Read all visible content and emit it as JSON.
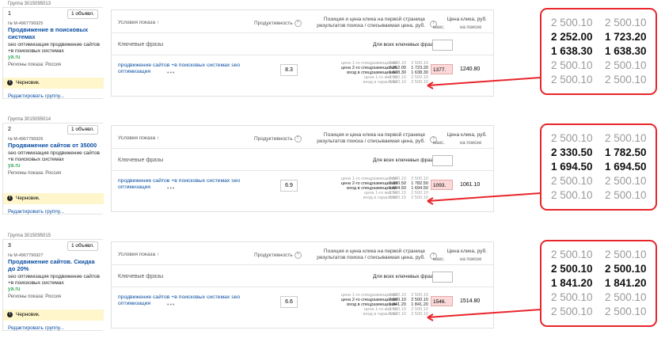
{
  "blocks": [
    {
      "group": "Группа 3015095013",
      "num": "1",
      "ads_button": "1 объявл.",
      "ad_id": "№ М-4967796925",
      "title": "Продвижение в поисковых системах",
      "text": "seo оптимизация продвижение сайтов +в поисковых системах",
      "domain": "ya.ru",
      "regions": "Регионы показа: Россия",
      "draft": "Черновик.",
      "edit": "Редактировать группу...",
      "phrase": "продвижение сайтов +в поисковых системах seo оптимизация",
      "productivity": "8.3",
      "labels": [
        "цена 1-го спецразмещения",
        "цена 2-го спецразмещения",
        "вход в спецразмещение",
        "цена 1-го места",
        "вход в гарантию"
      ],
      "col1": [
        "2 500.10",
        "2 252.00",
        "1 638.30",
        "2 500.10",
        "2 500.10"
      ],
      "col2": [
        "2 500.10",
        "1 723.20",
        "1 638.30",
        "2 500.10",
        "2 500.10"
      ],
      "bid_max": "1377.",
      "on_search": "1240.80",
      "zoom": [
        [
          "2 500.10",
          "2 500.10"
        ],
        [
          "2 252.00",
          "1 723.20"
        ],
        [
          "1 638.30",
          "1 638.30"
        ],
        [
          "2 500.10",
          "2 500.10"
        ],
        [
          "2 500.10",
          "2 500.10"
        ]
      ]
    },
    {
      "group": "Группа 3015095014",
      "num": "2",
      "ads_button": "1 объявл.",
      "ad_id": "№ М-4967796926",
      "title": "Продвижение сайтов от 35000",
      "text": "seo оптимизация продвижение сайтов +в поисковых системах",
      "domain": "ya.ru",
      "regions": "Регионы показа: Россия",
      "draft": "Черновик.",
      "edit": "Редактировать группу...",
      "phrase": "продвижение сайтов +в поисковых системах seo оптимизация",
      "productivity": "6.9",
      "labels": [
        "цена 1-го спецразмещения",
        "цена 2-го спецразмещения",
        "вход в спецразмещение",
        "цена 1-го места",
        "вход в гарантию"
      ],
      "col1": [
        "2 500.10",
        "2 330.50",
        "1 694.50",
        "2 500.10",
        "2 500.10"
      ],
      "col2": [
        "2 500.10",
        "1 782.50",
        "1 694.50",
        "2 500.10",
        "2 500.10"
      ],
      "bid_max": "1093.",
      "on_search": "1061.10",
      "zoom": [
        [
          "2 500.10",
          "2 500.10"
        ],
        [
          "2 330.50",
          "1 782.50"
        ],
        [
          "1 694.50",
          "1 694.50"
        ],
        [
          "2 500.10",
          "2 500.10"
        ],
        [
          "2 500.10",
          "2 500.10"
        ]
      ]
    },
    {
      "group": "Группа 3015095015",
      "num": "3",
      "ads_button": "1 объявл.",
      "ad_id": "№ М-4967796927",
      "title": "Продвижение сайтов. Скидка до 20%",
      "text": "seo оптимизация продвижение сайтов +в поисковых системах",
      "domain": "ya.ru",
      "regions": "Регионы показа: Россия",
      "draft": "Черновик.",
      "edit": "Редактировать группу...",
      "phrase": "продвижение сайтов +в поисковых системах seo оптимизация",
      "productivity": "6.6",
      "labels": [
        "цена 1-го спецразмещения",
        "цена 2-го спецразмещения",
        "вход в спецразмещение",
        "цена 1-го места",
        "вход в гарантию"
      ],
      "col1": [
        "2 500.10",
        "2 500.10",
        "1 841.20",
        "2 500.10",
        "2 500.10"
      ],
      "col2": [
        "2 500.10",
        "2 500.10",
        "1 841.20",
        "2 500.10",
        "2 500.10"
      ],
      "bid_max": "1546.",
      "on_search": "1514.80",
      "zoom": [
        [
          "2 500.10",
          "2 500.10"
        ],
        [
          "2 500.10",
          "2 500.10"
        ],
        [
          "1 841.20",
          "1 841.20"
        ],
        [
          "2 500.10",
          "2 500.10"
        ],
        [
          "2 500.10",
          "2 500.10"
        ]
      ]
    }
  ],
  "table_headers": {
    "condition": "Условия показа ↑",
    "productivity": "Продуктивность",
    "position_line1": "Позиция и цена клика на первой странице",
    "position_line2": "результатов поиска / списываемая цена, руб.",
    "bid_line1": "Цена клика, руб.",
    "max": "макс.",
    "on_search": "на поиске",
    "keywords": "Ключевые фразы",
    "all_keywords": "Для всех ключевых фраз:"
  },
  "colors": {
    "link": "#0b4ea2",
    "domain": "#0a8f2a",
    "draft_bg": "#fff6cc",
    "bid_bg": "#fbd9d9",
    "callout": "#e8252b"
  }
}
